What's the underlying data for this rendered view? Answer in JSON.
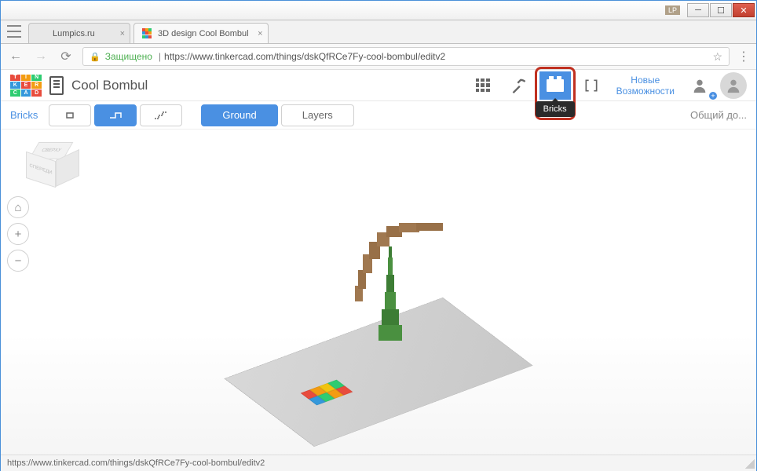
{
  "window": {
    "lp_badge": "LP"
  },
  "tabs": [
    {
      "title": "Lumpics.ru"
    },
    {
      "title": "3D design Cool Bombul"
    }
  ],
  "address": {
    "secure_label": "Защищено",
    "url": "https://www.tinkercad.com/things/dskQfRCe7Fy-cool-bombul/editv2"
  },
  "app": {
    "logo_letters": [
      "T",
      "I",
      "N",
      "K",
      "E",
      "R",
      "C",
      "A",
      "D"
    ],
    "project_title": "Cool Bombul",
    "bricks_tooltip": "Bricks",
    "new_features": "Новые\nВозможности"
  },
  "toolbar": {
    "bricks_label": "Bricks",
    "ground_label": "Ground",
    "layers_label": "Layers",
    "share_label": "Общий до..."
  },
  "viewcube": {
    "top": "СВЕРХУ",
    "front": "СПЕРЕДИ"
  },
  "nav": {
    "home": "⌂",
    "plus": "+",
    "minus": "−"
  },
  "statusbar": {
    "url": "https://www.tinkercad.com/things/dskQfRCe7Fy-cool-bombul/editv2"
  },
  "colors": {
    "logo": [
      "#e84c3d",
      "#f39c12",
      "#2ecc71",
      "#3498db",
      "#e84c3d",
      "#f39c12",
      "#2ecc71",
      "#3498db",
      "#e84c3d"
    ],
    "palette": [
      "#e84c3d",
      "#f39c12",
      "#f1c40f",
      "#2ecc71",
      "#3498db",
      "#2ecc71",
      "#f39c12",
      "#e84c3d"
    ]
  }
}
